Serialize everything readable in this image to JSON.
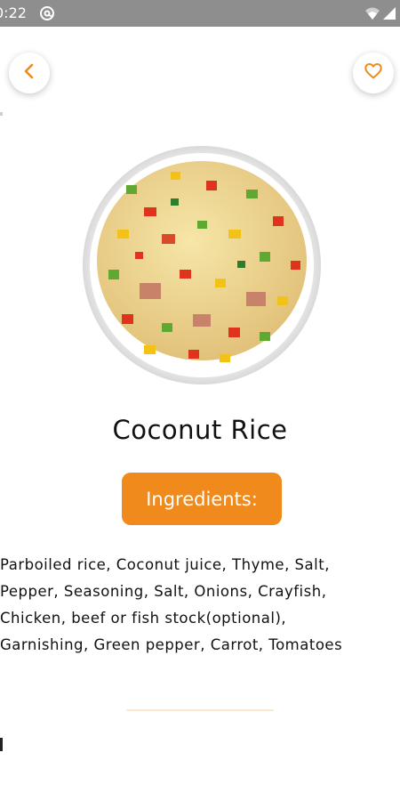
{
  "status_bar": {
    "time": "0:22",
    "app_icon": "at-sign-icon",
    "wifi_icon": "wifi-icon",
    "signal_icon": "signal-icon"
  },
  "header": {
    "back_icon": "chevron-left-icon",
    "favorite_icon": "heart-outline-icon"
  },
  "recipe": {
    "image": "coconut-rice-dish",
    "title": "Coconut Rice",
    "ingredients_button": "Ingredients:",
    "ingredients_text": "Parboiled rice, Coconut juice, Thyme, Salt,\nPepper, Seasoning, Salt, Onions, Crayfish,\nChicken, beef or fish stock(optional),\nGarnishing, Green pepper, Carrot, Tomatoes"
  },
  "colors": {
    "accent": "#f08a1c",
    "status_bar": "#8e8e8e",
    "divider": "#fbe7d2"
  }
}
